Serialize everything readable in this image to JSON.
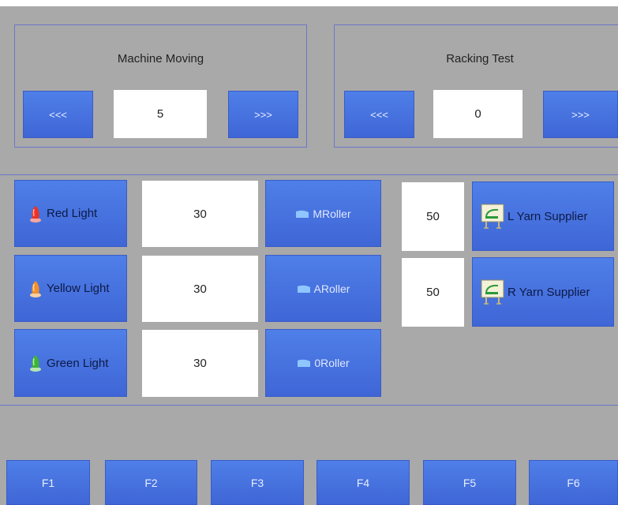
{
  "machine_moving": {
    "title": "Machine Moving",
    "prev_label": "<<<",
    "next_label": ">>>",
    "value": "5"
  },
  "racking_test": {
    "title": "Racking Test",
    "prev_label": "<<<",
    "next_label": ">>>",
    "value": "0"
  },
  "lights": [
    {
      "label": "Red Light",
      "value": "30",
      "icon": "red-bulb-icon",
      "color": "#e8332a"
    },
    {
      "label": "Yellow Light",
      "value": "30",
      "icon": "yellow-bulb-icon",
      "color": "#f0902a"
    },
    {
      "label": "Green Light",
      "value": "30",
      "icon": "green-bulb-icon",
      "color": "#3fb23a"
    }
  ],
  "rollers": [
    {
      "label": "MRoller",
      "icon": "roller-icon"
    },
    {
      "label": "ARoller",
      "icon": "roller-icon"
    },
    {
      "label": "0Roller",
      "icon": "roller-icon"
    }
  ],
  "yarn_suppliers": [
    {
      "label": "L Yarn Supplier",
      "value": "50",
      "icon": "yarn-supplier-icon"
    },
    {
      "label": "R Yarn Supplier",
      "value": "50",
      "icon": "yarn-supplier-icon"
    }
  ],
  "function_keys": [
    "F1",
    "F2",
    "F3",
    "F4",
    "F5",
    "F6"
  ],
  "colors": {
    "background": "#a9a9a9",
    "button": "#4672e0",
    "border": "#6d76c9",
    "field": "#ffffff"
  }
}
